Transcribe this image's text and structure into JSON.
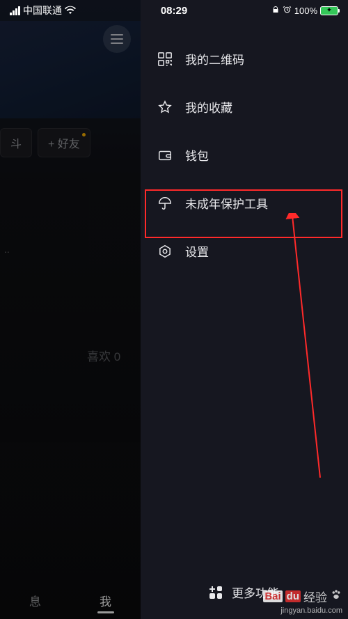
{
  "status_bar": {
    "carrier": "中国联通",
    "time": "08:29",
    "battery_pct": "100%"
  },
  "left_panel": {
    "pill1": "斗",
    "pill2": "+ 好友",
    "likes_label": "喜欢 0",
    "tab_msg": "息",
    "tab_me": "我"
  },
  "drawer": {
    "items": [
      {
        "label": "我的二维码"
      },
      {
        "label": "我的收藏"
      },
      {
        "label": "钱包"
      },
      {
        "label": "未成年保护工具"
      },
      {
        "label": "设置"
      }
    ],
    "more_label": "更多功能"
  },
  "watermark": {
    "bai": "Bai",
    "du": "du",
    "brand": "经验",
    "url": "jingyan.baidu.com"
  }
}
